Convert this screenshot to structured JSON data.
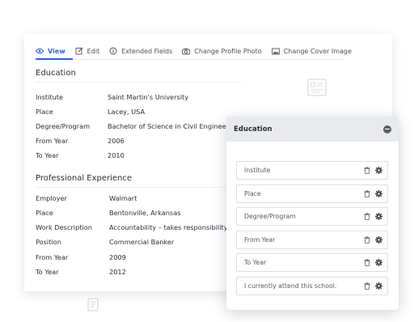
{
  "tabs": [
    {
      "label": "View",
      "icon": "eye-icon",
      "active": true
    },
    {
      "label": "Edit",
      "icon": "pencil-icon",
      "active": false
    },
    {
      "label": "Extended Fields",
      "icon": "info-icon",
      "active": false
    },
    {
      "label": "Change Profile Photo",
      "icon": "camera-icon",
      "active": false
    },
    {
      "label": "Change Cover Image",
      "icon": "image-icon",
      "active": false
    }
  ],
  "education": {
    "title": "Education",
    "rows": [
      {
        "key": "Institute",
        "value": "Saint Martin's University"
      },
      {
        "key": "Place",
        "value": "Lacey, USA"
      },
      {
        "key": "Degree/Program",
        "value": "Bachelor of Science in Civil Engineer"
      },
      {
        "key": "From Year",
        "value": "2006"
      },
      {
        "key": "To Year",
        "value": "2010"
      }
    ]
  },
  "experience": {
    "title": "Professional Experience",
    "rows": [
      {
        "key": "Employer",
        "value": "Walmart"
      },
      {
        "key": "Place",
        "value": "Bentonville, Arkansas"
      },
      {
        "key": "Work Description",
        "value": "Accountability – takes responsibility"
      },
      {
        "key": "Position",
        "value": "Commercial Banker"
      },
      {
        "key": "From Year",
        "value": "2009"
      },
      {
        "key": "To Year",
        "value": "2012"
      }
    ]
  },
  "panel": {
    "title": "Education",
    "fields": [
      {
        "label": "Institute"
      },
      {
        "label": "Place"
      },
      {
        "label": "Degree/Program"
      },
      {
        "label": "From Year"
      },
      {
        "label": "To Year"
      },
      {
        "label": "I currently attend this school."
      }
    ]
  },
  "colors": {
    "accent": "#2f63d8",
    "panel_header": "#e9eaee",
    "text": "#2b2f36"
  }
}
